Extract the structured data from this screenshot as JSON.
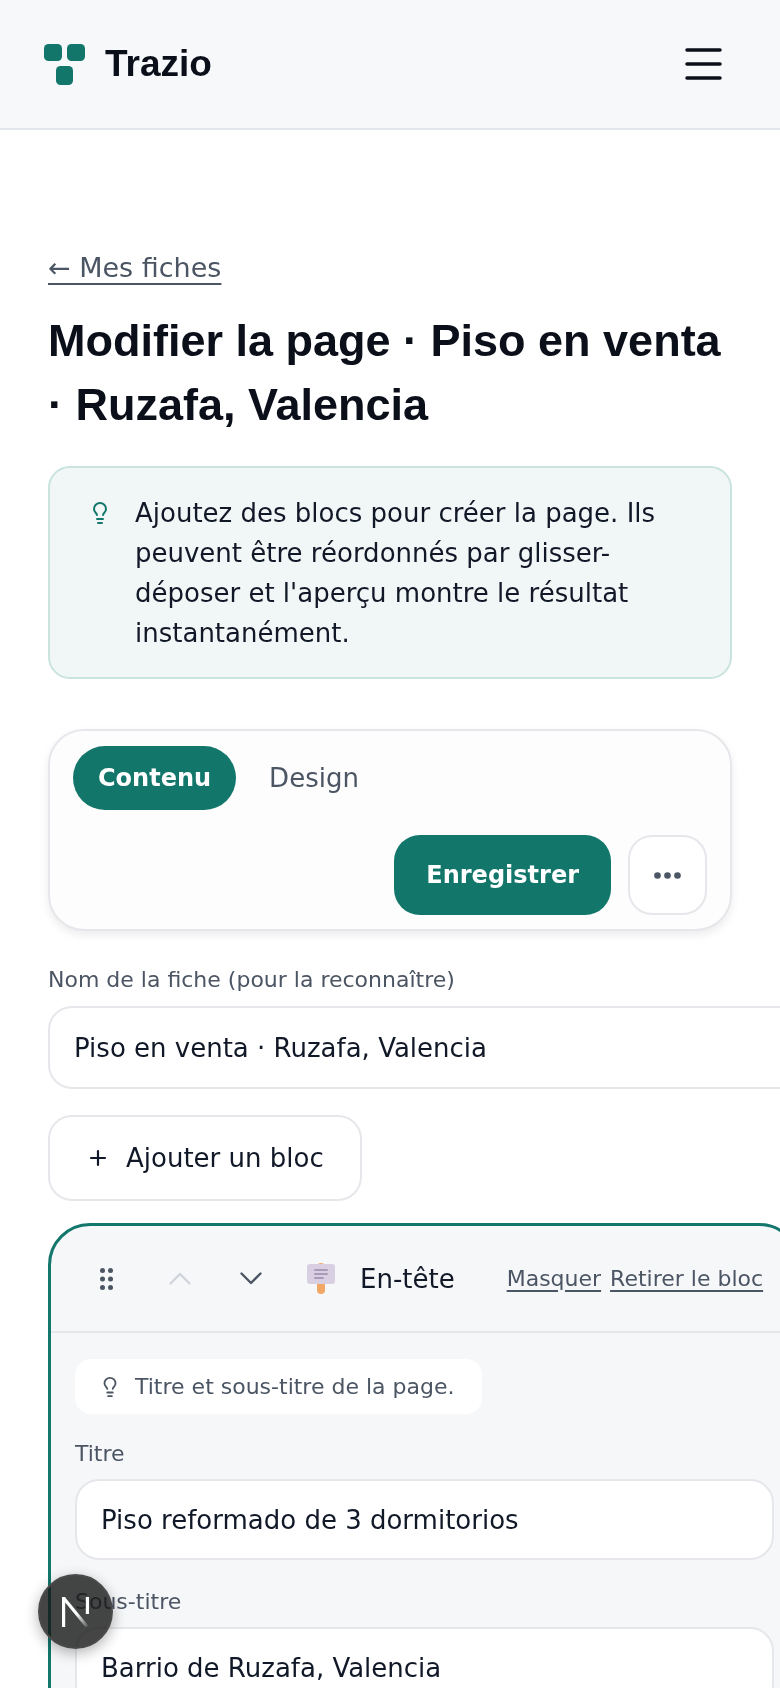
{
  "header": {
    "brand": "Trazio"
  },
  "back_link": "← Mes fiches",
  "page_title": "Modifier la page · Piso en venta · Ruzafa, Valencia",
  "info_banner": {
    "text": "Ajoutez des blocs pour créer la page. Ils peuvent être réordonnés par glisser-déposer et l'aperçu montre le résultat instantanément."
  },
  "tabs": [
    {
      "label": "Contenu",
      "selected": true
    },
    {
      "label": "Design",
      "selected": false
    }
  ],
  "toolbar": {
    "save_button": "Enregistrer"
  },
  "name_field": {
    "label": "Nom de la fiche (pour la reconnaître)",
    "value": "Piso en venta · Ruzafa, Valencia"
  },
  "add_block_button": "Ajouter un bloc",
  "blocks": [
    {
      "kind": "header",
      "selected": true,
      "title": "En-tête",
      "move_up_disabled": true,
      "move_down_disabled": false,
      "hide_link": "Masquer",
      "remove_link": "Retirer le bloc",
      "hint": "Titre et sous-titre de la page.",
      "fields": [
        {
          "label": "Titre",
          "value": "Piso reformado de 3 dormitorios"
        },
        {
          "label": "Sous-titre",
          "value": "Barrio de Ruzafa, Valencia"
        }
      ]
    }
  ]
}
